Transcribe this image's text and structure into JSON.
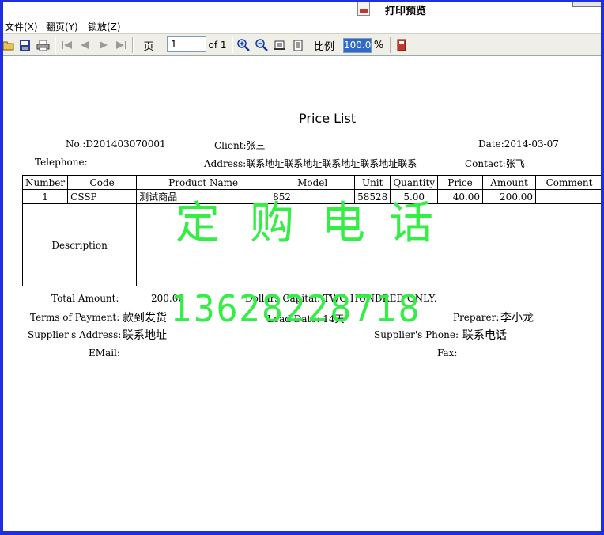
{
  "window": {
    "title": "打印预览"
  },
  "menu": [
    {
      "label": "文件(X)"
    },
    {
      "label": "翻页(Y)"
    },
    {
      "label": "锁放(Z)"
    }
  ],
  "toolbar": {
    "page_label": "页",
    "page_value": "1",
    "of_label": "of 1",
    "ratio_label": "比例",
    "zoom_value": "100.0",
    "percent_label": "%",
    "icons": [
      "open-icon",
      "save-icon",
      "print-icon",
      "first-page-icon",
      "prev-page-icon",
      "next-page-icon",
      "last-page-icon",
      "zoom-in-icon",
      "zoom-out-icon",
      "page-setup-icon",
      "document-icon",
      "exit-icon"
    ]
  },
  "report": {
    "title": "Price List",
    "no": "No.:D201403070001",
    "client": "Client:张三",
    "date": "Date:2014-03-07",
    "telephone": "Telephone:",
    "address": "Address:联系地址联系地址联系地址联系地址联系",
    "contact": "Contact:张飞",
    "table": {
      "headers": [
        "Number",
        "Code",
        "Product  Name",
        "Model",
        "Unit",
        "Quantity",
        "Price",
        "Amount",
        "Comment"
      ],
      "rows": [
        [
          "1",
          "CSSP",
          "测试商品",
          "852",
          "58528",
          "5.00",
          "40.00",
          "200.00",
          ""
        ]
      ],
      "description_label": "Description"
    },
    "total_amount_label": "Total  Amount:",
    "total_amount": "200.00",
    "dollars_capital": "Dollars  Capital:  TWO HUNDRED ONLY.",
    "terms_label": "Terms  of  Payment:",
    "terms_value": "款到发货",
    "lead_date": "Lead  Date:  14天",
    "preparer_label": "Preparer:",
    "preparer_value": "李小龙",
    "supplier_address_label": "Supplier's  Address:",
    "supplier_address_value": "联系地址",
    "supplier_phone_label": "Supplier's  Phone:",
    "supplier_phone_value": "联系电话",
    "email_label": "EMail:",
    "fax_label": "Fax:"
  },
  "watermark": {
    "chars": [
      "定",
      "购",
      "电",
      "话"
    ],
    "phone": "13628228718",
    "color": "#33ee44"
  }
}
